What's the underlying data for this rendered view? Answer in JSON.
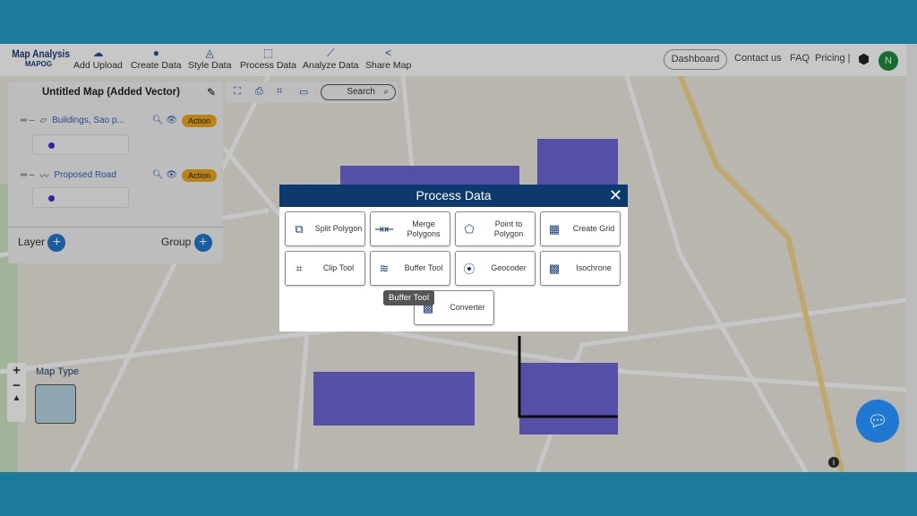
{
  "header": {
    "logo_title": "Map Analysis",
    "logo_sub": "MAPOG",
    "nav": [
      {
        "icon": "cloud-upload-icon",
        "label": "Add Upload"
      },
      {
        "icon": "map-pin-icon",
        "label": "Create Data"
      },
      {
        "icon": "paint-bucket-icon",
        "label": "Style Data"
      },
      {
        "icon": "process-icon",
        "label": "Process Data"
      },
      {
        "icon": "analyze-icon",
        "label": "Analyze Data"
      },
      {
        "icon": "share-icon",
        "label": "Share Map"
      }
    ],
    "dashboard": "Dashboard",
    "contact": "Contact us",
    "faq": "FAQ",
    "pricing": "Pricing |",
    "avatar": "N"
  },
  "panel": {
    "title": "Untitled Map (Added Vector)",
    "layers": [
      {
        "name": "Buildings, Sao p...",
        "action": "Action",
        "color": "#3b2fd6"
      },
      {
        "name": "Proposed Road",
        "action": "Action",
        "color": "#3b2fd6"
      }
    ],
    "layer_label": "Layer",
    "group_label": "Group"
  },
  "toolbar": {
    "search": "Search"
  },
  "map": {
    "map_type": "Map Type"
  },
  "modal": {
    "title": "Process Data",
    "tools": [
      {
        "label": "Split Polygon",
        "icon": "split-polygon-icon"
      },
      {
        "label": "Merge Polygons",
        "icon": "merge-icon"
      },
      {
        "label": "Point to Polygon",
        "icon": "point-polygon-icon"
      },
      {
        "label": "Create Grid",
        "icon": "grid-icon"
      },
      {
        "label": "Clip Tool",
        "icon": "crop-icon"
      },
      {
        "label": "Buffer Tool",
        "icon": "layers-icon"
      },
      {
        "label": "Geocoder",
        "icon": "location-icon"
      },
      {
        "label": "Isochrone",
        "icon": "isochrone-icon"
      },
      {
        "label": "Converter",
        "icon": "converter-icon"
      }
    ],
    "tooltip": "Buffer Tool"
  }
}
